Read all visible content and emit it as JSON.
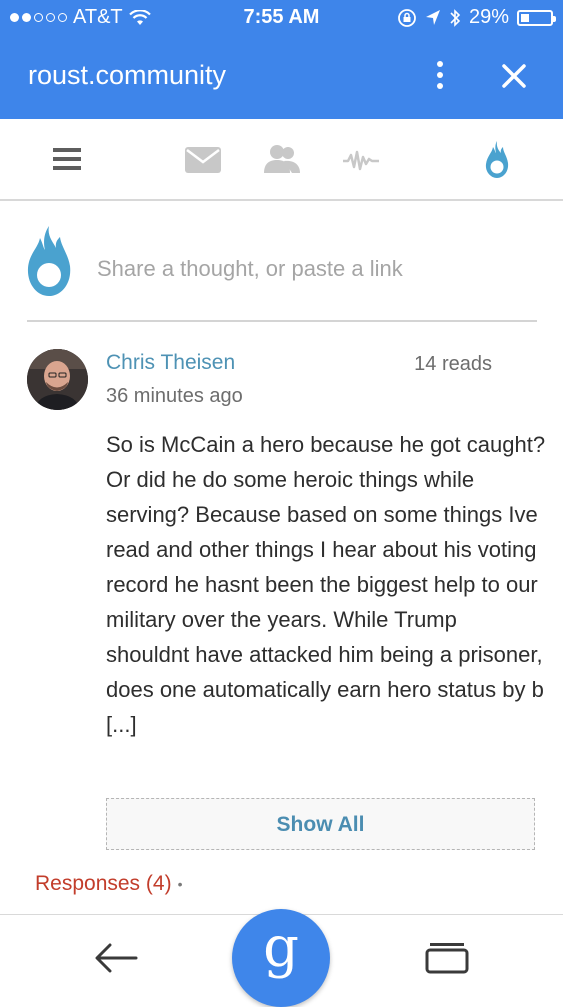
{
  "status_bar": {
    "carrier": "AT&T",
    "time": "7:55 AM",
    "battery": "29%",
    "battery_level": 0.29,
    "signal_bars": 2
  },
  "browser": {
    "url": "roust.community"
  },
  "nav": {
    "icons": [
      "menu-icon",
      "mail-icon",
      "people-icon",
      "activity-icon",
      "flame-icon"
    ],
    "active": "flame-icon"
  },
  "composer": {
    "placeholder": "Share a thought, or paste a link"
  },
  "post": {
    "author": "Chris Theisen",
    "time_ago": "36 minutes ago",
    "reads": "14 reads",
    "body": "So is McCain a hero because he got caught? Or did he do some heroic things while serving? Because based on some things Ive read and other things I hear about his voting record he hasnt been the biggest help to our military over the years. While Trump shouldnt have attacked him being a prisoner, does one automatically earn hero status by b [...]",
    "show_all_label": "Show All",
    "responses_label": "Responses (4)",
    "responses_separator": "•"
  },
  "bottom_bar": {
    "google_button_label": "g"
  },
  "colors": {
    "brand_blue": "#3e85ea",
    "author_blue": "#4e92b4",
    "flame_blue": "#4aa2cf",
    "responses_red": "#c23d2b"
  }
}
